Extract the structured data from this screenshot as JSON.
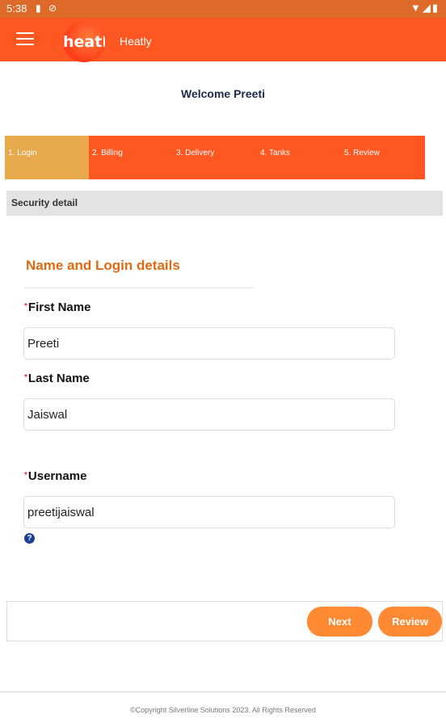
{
  "status_bar": {
    "time": "5:38",
    "left_icons": [
      "sd-card-icon",
      "do-not-disturb-icon"
    ],
    "right_icons": [
      "wifi-icon",
      "signal-icon",
      "battery-icon"
    ]
  },
  "app_bar": {
    "logo_text": "heatl",
    "title": "Heatly"
  },
  "welcome": "Welcome Preeti",
  "steps": [
    {
      "label": "1. Login",
      "active": true
    },
    {
      "label": "2. Billing",
      "active": false
    },
    {
      "label": "3. Delivery",
      "active": false
    },
    {
      "label": "4. Tanks",
      "active": false
    },
    {
      "label": "5. Review",
      "active": false
    }
  ],
  "section_bar": "Security detail",
  "form": {
    "title": "Name and Login details",
    "required_marker": "*",
    "first_name": {
      "label": "First Name",
      "value": "Preeti"
    },
    "last_name": {
      "label": "Last Name",
      "value": "Jaiswal"
    },
    "username": {
      "label": "Username",
      "value": "preetijaiswal"
    },
    "help_icon": "?"
  },
  "buttons": {
    "next": "Next",
    "review": "Review"
  },
  "footer": {
    "copyright": "©Copyright Silverline Solutions 2023. All Rights Reserved"
  },
  "colors": {
    "app_bar": "#ff5722",
    "status_bar": "#dd6a28",
    "active_step": "#e8a84c",
    "section_title": "#e06a12",
    "button": "#ff8a33"
  }
}
